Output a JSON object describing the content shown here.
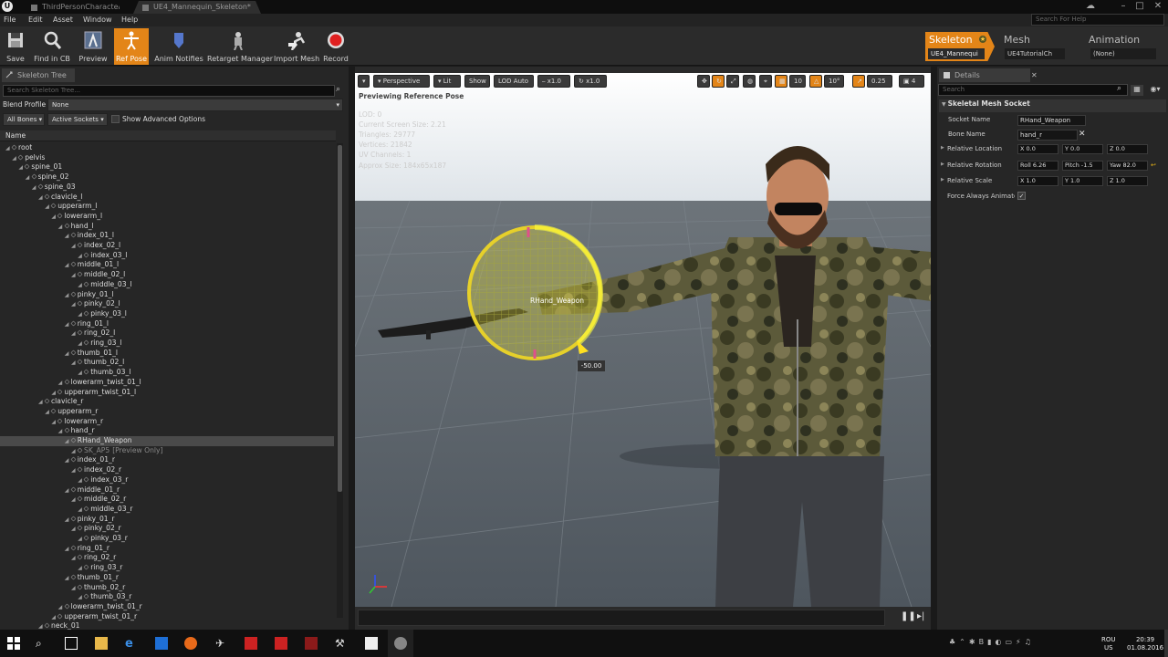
{
  "titlebar": {
    "tabs": [
      "ThirdPersonCharacter",
      "UE4_Mannequin_Skeleton*"
    ]
  },
  "menu": [
    "File",
    "Edit",
    "Asset",
    "Window",
    "Help"
  ],
  "search_help_placeholder": "Search For Help",
  "toolbar": {
    "buttons": [
      "Save",
      "Find in CB",
      "Preview",
      "Ref Pose",
      "Anim Notifies",
      "Retarget Manager",
      "Import Mesh",
      "Record"
    ]
  },
  "modes": {
    "skeleton": "Skeleton",
    "skeleton_asset": "UE4_Mannequi",
    "mesh": "Mesh",
    "mesh_asset": "UE4TutorialCh",
    "animation": "Animation",
    "animation_asset": "(None)"
  },
  "skeleton_tree": {
    "tab": "Skeleton Tree",
    "search_placeholder": "Search Skeleton Tree...",
    "blend_profile_label": "Blend Profile",
    "blend_profile_value": "None",
    "all_bones": "All Bones",
    "active_sockets": "Active Sockets",
    "show_advanced": "Show Advanced Options",
    "column": "Name",
    "rows": [
      {
        "label": "root",
        "depth": 0
      },
      {
        "label": "pelvis",
        "depth": 1
      },
      {
        "label": "spine_01",
        "depth": 2
      },
      {
        "label": "spine_02",
        "depth": 3
      },
      {
        "label": "spine_03",
        "depth": 4
      },
      {
        "label": "clavicle_l",
        "depth": 5
      },
      {
        "label": "upperarm_l",
        "depth": 6
      },
      {
        "label": "lowerarm_l",
        "depth": 7
      },
      {
        "label": "hand_l",
        "depth": 8
      },
      {
        "label": "index_01_l",
        "depth": 9
      },
      {
        "label": "index_02_l",
        "depth": 10
      },
      {
        "label": "index_03_l",
        "depth": 11
      },
      {
        "label": "middle_01_l",
        "depth": 9
      },
      {
        "label": "middle_02_l",
        "depth": 10
      },
      {
        "label": "middle_03_l",
        "depth": 11
      },
      {
        "label": "pinky_01_l",
        "depth": 9
      },
      {
        "label": "pinky_02_l",
        "depth": 10
      },
      {
        "label": "pinky_03_l",
        "depth": 11
      },
      {
        "label": "ring_01_l",
        "depth": 9
      },
      {
        "label": "ring_02_l",
        "depth": 10
      },
      {
        "label": "ring_03_l",
        "depth": 11
      },
      {
        "label": "thumb_01_l",
        "depth": 9
      },
      {
        "label": "thumb_02_l",
        "depth": 10
      },
      {
        "label": "thumb_03_l",
        "depth": 11
      },
      {
        "label": "lowerarm_twist_01_l",
        "depth": 8
      },
      {
        "label": "upperarm_twist_01_l",
        "depth": 7
      },
      {
        "label": "clavicle_r",
        "depth": 5
      },
      {
        "label": "upperarm_r",
        "depth": 6
      },
      {
        "label": "lowerarm_r",
        "depth": 7
      },
      {
        "label": "hand_r",
        "depth": 8
      },
      {
        "label": "RHand_Weapon",
        "depth": 9,
        "selected": true
      },
      {
        "label": "SK_AP5",
        "suffix": "[Preview Only]",
        "depth": 10,
        "dim": true
      },
      {
        "label": "index_01_r",
        "depth": 9
      },
      {
        "label": "index_02_r",
        "depth": 10
      },
      {
        "label": "index_03_r",
        "depth": 11
      },
      {
        "label": "middle_01_r",
        "depth": 9
      },
      {
        "label": "middle_02_r",
        "depth": 10
      },
      {
        "label": "middle_03_r",
        "depth": 11
      },
      {
        "label": "pinky_01_r",
        "depth": 9
      },
      {
        "label": "pinky_02_r",
        "depth": 10
      },
      {
        "label": "pinky_03_r",
        "depth": 11
      },
      {
        "label": "ring_01_r",
        "depth": 9
      },
      {
        "label": "ring_02_r",
        "depth": 10
      },
      {
        "label": "ring_03_r",
        "depth": 11
      },
      {
        "label": "thumb_01_r",
        "depth": 9
      },
      {
        "label": "thumb_02_r",
        "depth": 10
      },
      {
        "label": "thumb_03_r",
        "depth": 11
      },
      {
        "label": "lowerarm_twist_01_r",
        "depth": 8
      },
      {
        "label": "upperarm_twist_01_r",
        "depth": 7
      },
      {
        "label": "neck_01",
        "depth": 5
      }
    ]
  },
  "viewport": {
    "perspective": "Perspective",
    "lit": "Lit",
    "show": "Show",
    "lod": "LOD Auto",
    "speed1": "x1.0",
    "speed2": "x1.0",
    "grid_snap": "10",
    "rot_snap": "10°",
    "scale_snap": "0.25",
    "cam_speed": "4",
    "preview_note": "Previewing Reference Pose",
    "stats": [
      "LOD: 0",
      "Current Screen Size: 2.21",
      "Triangles: 29777",
      "Vertices: 21842",
      "UV Channels: 1",
      "Approx Size: 184x65x187"
    ],
    "socket_label": "RHand_Weapon",
    "rotation_readout": "-50.00"
  },
  "details": {
    "tab": "Details",
    "search_placeholder": "Search",
    "section": "Skeletal Mesh Socket",
    "socket_name_label": "Socket Name",
    "socket_name": "RHand_Weapon",
    "bone_name_label": "Bone Name",
    "bone_name": "hand_r",
    "rel_loc_label": "Relative Location",
    "rel_loc": [
      "X 0.0",
      "Y 0.0",
      "Z 0.0"
    ],
    "rel_rot_label": "Relative Rotation",
    "rel_rot": [
      "Roll 6.26",
      "Pitch -1.5",
      "Yaw 82.0"
    ],
    "rel_scale_label": "Relative Scale",
    "rel_scale": [
      "X 1.0",
      "Y 1.0",
      "Z 1.0"
    ],
    "force_anim_label": "Force Always Animated"
  },
  "taskbar": {
    "lang": "ROU",
    "region": "US",
    "time": "20:39",
    "date": "01.08.2016"
  }
}
